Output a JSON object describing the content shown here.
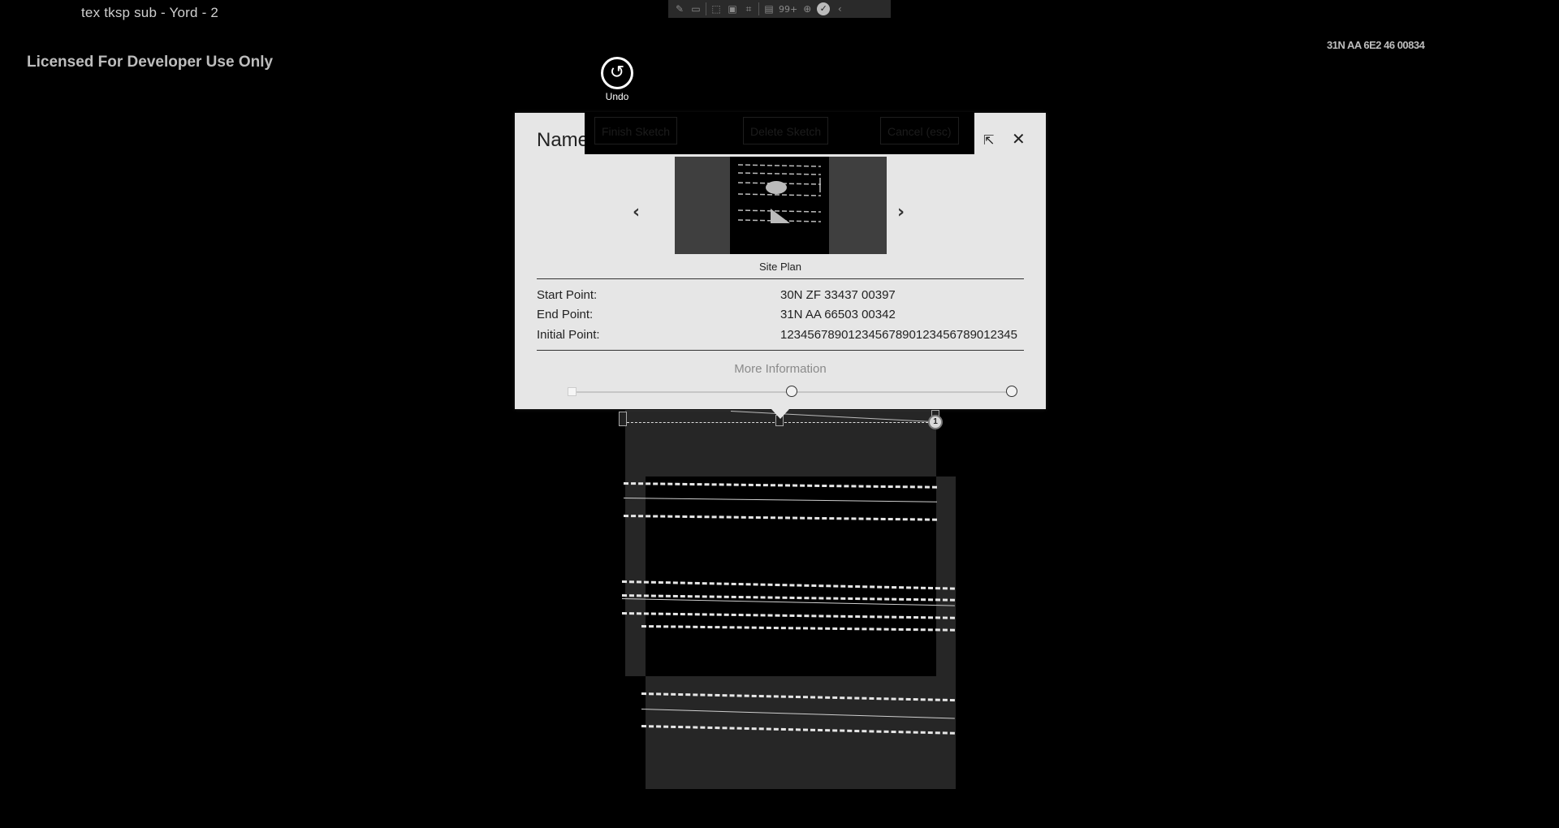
{
  "window": {
    "title": "tex tksp sub - Yord - 2"
  },
  "license": "Licensed For Developer Use Only",
  "coord_readout": "31N AA 6E2 46 00834",
  "toolbar": {
    "icons": [
      "edit-icon",
      "video-icon",
      "cursor-icon",
      "frame-icon",
      "crop-icon",
      "layers-icon",
      "zoom-icon",
      "check-icon",
      "collapse-icon"
    ],
    "badge": "99+"
  },
  "undo": {
    "label": "Undo",
    "icon": "undo-icon"
  },
  "dialog": {
    "title": "Name",
    "actions": {
      "finish": "Finish Sketch",
      "delete": "Delete Sketch",
      "cancel": "Cancel (esc)"
    },
    "carousel_caption": "Site Plan",
    "info": [
      {
        "label": "Start Point:",
        "value": "30N ZF 33437 00397"
      },
      {
        "label": "End Point:",
        "value": "31N AA 66503 00342"
      },
      {
        "label": "Initial Point:",
        "value": "12345678901234567890123456789012345"
      }
    ],
    "more_info": "More Information",
    "slider_value": 0.5
  },
  "marker_label": "1"
}
